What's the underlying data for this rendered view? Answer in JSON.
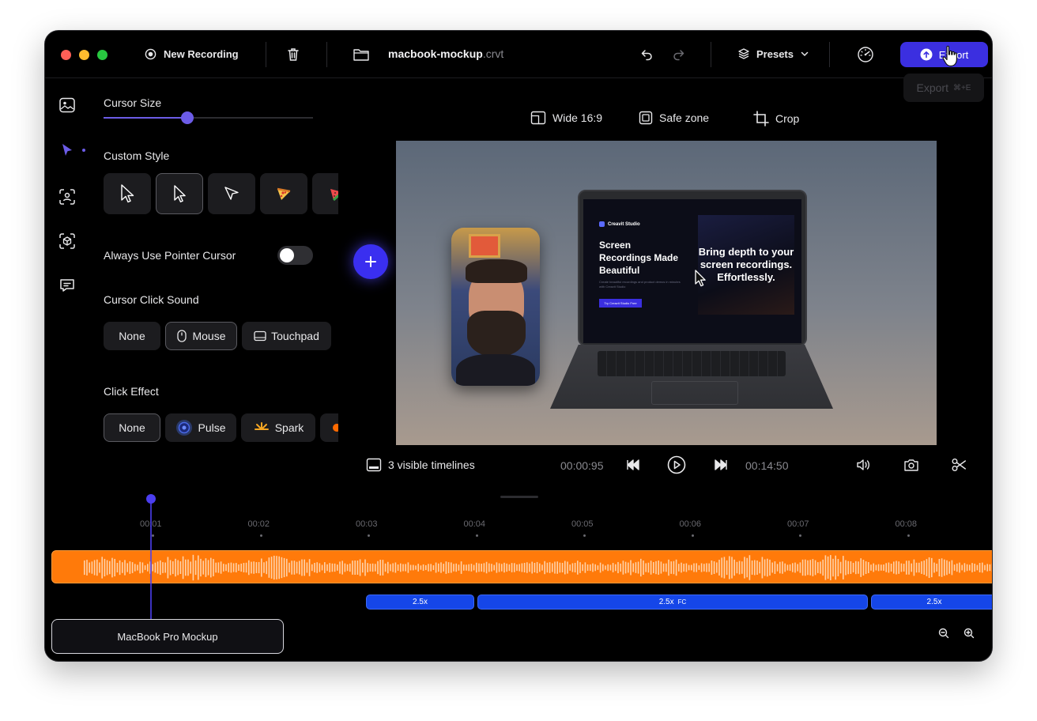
{
  "window": {
    "traffic": {
      "close": "#ff5f57",
      "min": "#febc2e",
      "max": "#28c840"
    },
    "new_recording": "New Recording",
    "file_name": "macbook-mockup",
    "file_ext": ".crvt",
    "presets": "Presets",
    "export": "Export",
    "export_tooltip": "Export",
    "export_shortcut": "⌘+E"
  },
  "settings": {
    "cursor_size_label": "Cursor Size",
    "cursor_size_value": 0.4,
    "custom_style_label": "Custom Style",
    "pointer_label": "Always Use Pointer Cursor",
    "pointer_on": false,
    "click_sound_label": "Cursor Click Sound",
    "sounds": [
      "None",
      "Mouse",
      "Touchpad"
    ],
    "click_effect_label": "Click Effect",
    "effects": [
      "None",
      "Pulse",
      "Spark"
    ]
  },
  "canvas_bar": {
    "aspect": "Wide 16:9",
    "safe_zone": "Safe zone",
    "crop": "Crop"
  },
  "screen": {
    "brand": "Creavit Studio",
    "headline": "Screen Recordings Made Beautiful",
    "body": "Create beautiful recordings and product demos in minutes with Creavit Studio",
    "cta": "Try Creavit Studio Free",
    "card_text": "Bring depth to your screen recordings. Effortlessly."
  },
  "playback": {
    "timelines": "3 visible timelines",
    "current": "00:00:95",
    "total": "00:14:50"
  },
  "timeline": {
    "ticks": [
      "00:01",
      "00:02",
      "00:03",
      "00:04",
      "00:05",
      "00:06",
      "00:07",
      "00:08"
    ],
    "segments": [
      {
        "label": "2.5x",
        "tag": ""
      },
      {
        "label": "2.5x",
        "tag": "FC"
      },
      {
        "label": "2.5x",
        "tag": ""
      }
    ],
    "track_name": "MacBook Pro Mockup"
  },
  "colors": {
    "accent": "#3b2fe0",
    "slider": "#6c5ce7",
    "audio": "#ff7a0a",
    "zoom_segment": "#1546e8"
  }
}
